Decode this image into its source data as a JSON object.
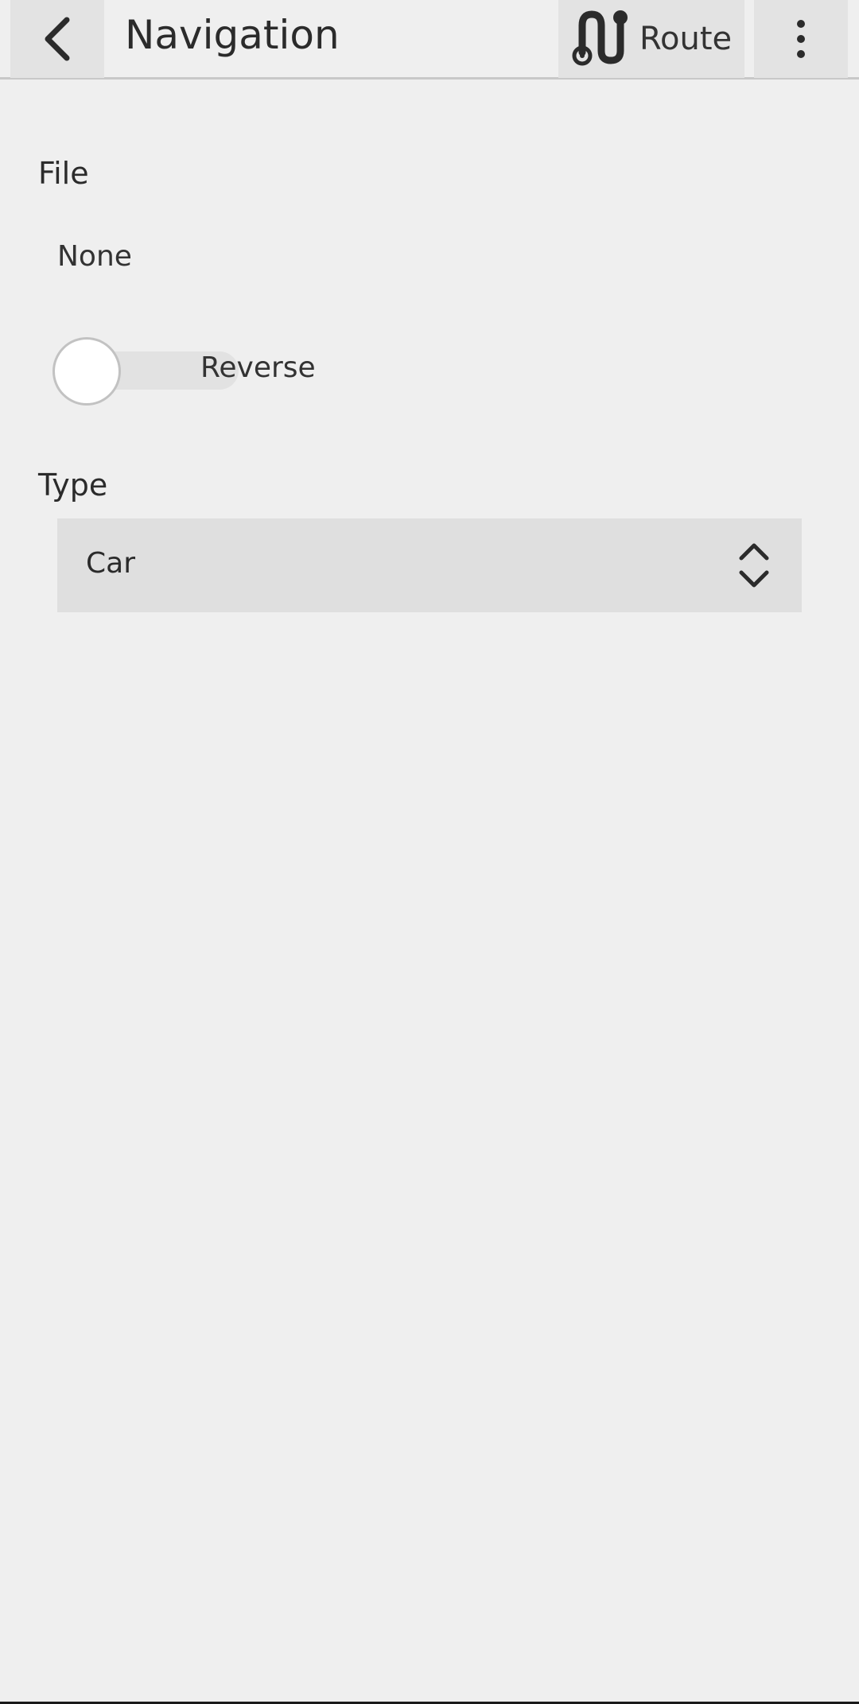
{
  "toolbar": {
    "title": "Navigation",
    "back_icon": "chevron-left-icon",
    "route_icon": "route-icon",
    "route_label": "Route",
    "menu_icon": "more-vertical-icon"
  },
  "file": {
    "label": "File",
    "value": "None"
  },
  "reverse": {
    "label": "Reverse",
    "checked": false
  },
  "type": {
    "label": "Type",
    "selected": "Car",
    "arrows_icon": "unfold-icon"
  },
  "colors": {
    "background": "#efefef",
    "button_bg": "#e3e3e3",
    "select_bg": "#dfdfdf",
    "text": "#2b2b2b"
  }
}
